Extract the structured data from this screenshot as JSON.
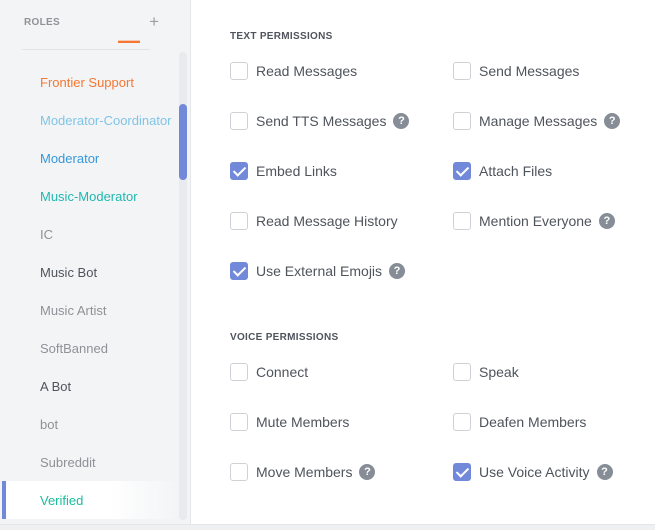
{
  "sidebar": {
    "title": "ROLES",
    "add_symbol": "+",
    "clipped_role_color": "#f57731",
    "roles": [
      {
        "label": "Frontier Support",
        "color": "#f57731"
      },
      {
        "label": "Moderator-Coordinator",
        "color": "#81c4e6"
      },
      {
        "label": "Moderator",
        "color": "#3498db"
      },
      {
        "label": "Music-Moderator",
        "color": "#1fb8b0"
      },
      {
        "label": "IC",
        "color": "#8e9297"
      },
      {
        "label": "Music Bot",
        "color": "#4f545c"
      },
      {
        "label": "Music Artist",
        "color": "#8e9297"
      },
      {
        "label": "SoftBanned",
        "color": "#8e9297"
      },
      {
        "label": "A Bot",
        "color": "#4f545c"
      },
      {
        "label": "bot",
        "color": "#8e9297"
      },
      {
        "label": "Subreddit",
        "color": "#8e9297"
      },
      {
        "label": "Verified",
        "color": "#1abc9c",
        "selected": true
      }
    ]
  },
  "text_permissions": {
    "title": "TEXT PERMISSIONS",
    "items": [
      {
        "label": "Read Messages",
        "checked": false,
        "help": false
      },
      {
        "label": "Send Messages",
        "checked": false,
        "help": false
      },
      {
        "label": "Send TTS Messages",
        "checked": false,
        "help": true
      },
      {
        "label": "Manage Messages",
        "checked": false,
        "help": true
      },
      {
        "label": "Embed Links",
        "checked": true,
        "help": false
      },
      {
        "label": "Attach Files",
        "checked": true,
        "help": false
      },
      {
        "label": "Read Message History",
        "checked": false,
        "help": false
      },
      {
        "label": "Mention Everyone",
        "checked": false,
        "help": true
      },
      {
        "label": "Use External Emojis",
        "checked": true,
        "help": true
      }
    ]
  },
  "voice_permissions": {
    "title": "VOICE PERMISSIONS",
    "items": [
      {
        "label": "Connect",
        "checked": false,
        "help": false
      },
      {
        "label": "Speak",
        "checked": false,
        "help": false
      },
      {
        "label": "Mute Members",
        "checked": false,
        "help": false
      },
      {
        "label": "Deafen Members",
        "checked": false,
        "help": false
      },
      {
        "label": "Move Members",
        "checked": false,
        "help": true
      },
      {
        "label": "Use Voice Activity",
        "checked": true,
        "help": true
      }
    ]
  },
  "help_symbol": "?",
  "colors": {
    "accent": "#7289da"
  },
  "icons": {
    "add": "plus-icon",
    "help": "question-mark-icon",
    "check": "checkmark-icon"
  }
}
